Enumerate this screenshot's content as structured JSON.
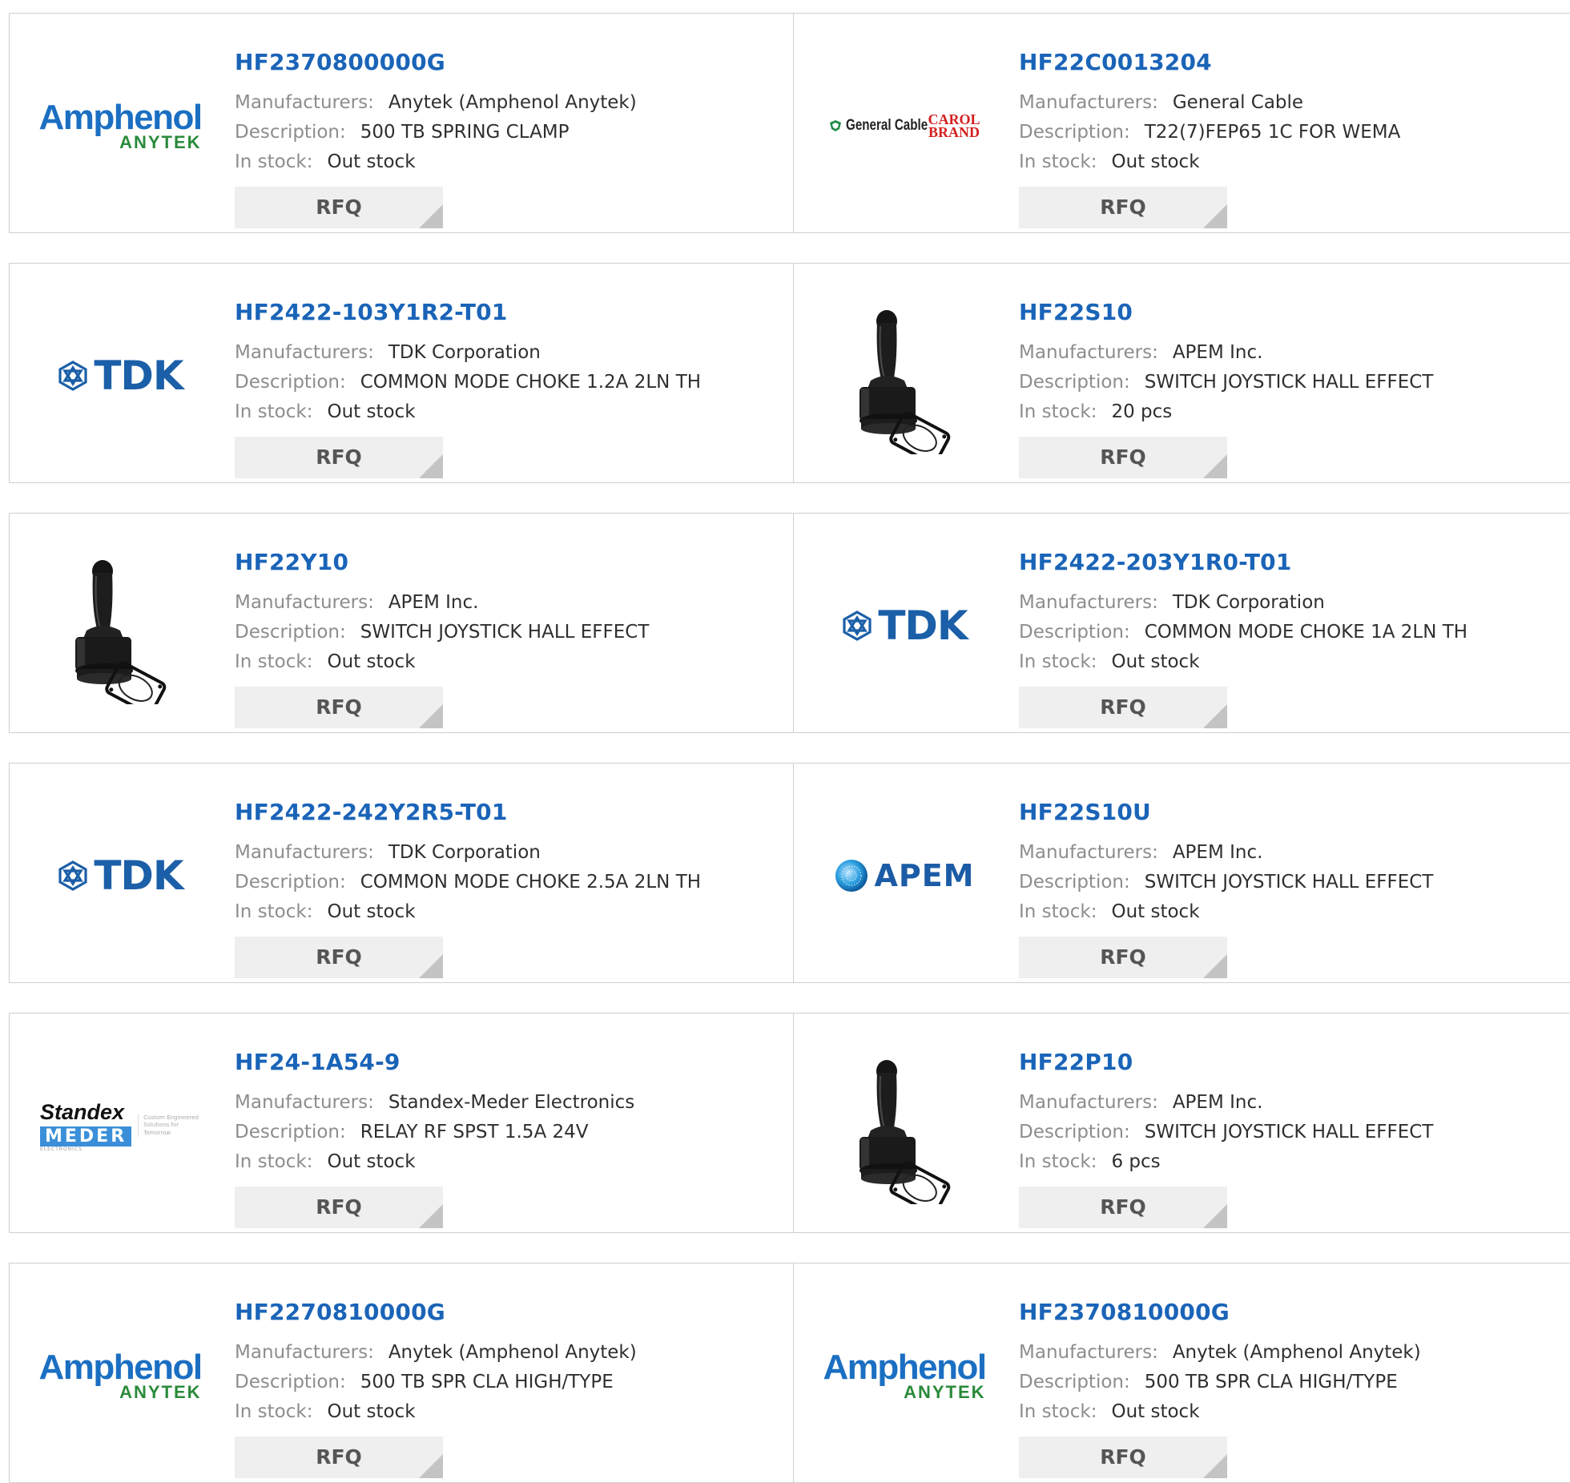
{
  "labels": {
    "manufacturers": "Manufacturers:",
    "description": "Description:",
    "in_stock": "In stock:",
    "rfq": "RFQ"
  },
  "brand_logos": {
    "amphenol": {
      "line1": "Amphenol",
      "line2": "ANYTEK"
    },
    "tdk": {
      "text": "TDK"
    },
    "apem": {
      "text": "APEM"
    },
    "general_cable": {
      "line1": "General Cable",
      "line2": "CAROL",
      "line3": "BRAND"
    },
    "standex": {
      "line1": "Standex",
      "line2": "MEDER",
      "line3": "ELECTRONICS",
      "tagline": "Custom Engineered Solutions for Tomorrow"
    }
  },
  "colors": {
    "part_link": "#1a64b8",
    "label": "#8d8d8d",
    "value": "#2f2f2f",
    "rfq_bg": "#efefef",
    "border": "#cfcfcf"
  },
  "products": [
    {
      "part": "HF2370800000G",
      "manufacturer": "Anytek (Amphenol Anytek)",
      "description": "500 TB SPRING CLAMP",
      "stock": "Out stock",
      "logo": "amphenol-logo"
    },
    {
      "part": "HF22C0013204",
      "manufacturer": "General Cable",
      "description": "T22(7)FEP65 1C FOR WEMA",
      "stock": "Out stock",
      "logo": "general-cable-logo"
    },
    {
      "part": "HF2422-103Y1R2-T01",
      "manufacturer": "TDK Corporation",
      "description": "COMMON MODE CHOKE 1.2A 2LN TH",
      "stock": "Out stock",
      "logo": "tdk-logo"
    },
    {
      "part": "HF22S10",
      "manufacturer": "APEM Inc.",
      "description": "SWITCH JOYSTICK HALL EFFECT",
      "stock": "20 pcs",
      "logo": "joystick-image"
    },
    {
      "part": "HF22Y10",
      "manufacturer": "APEM Inc.",
      "description": "SWITCH JOYSTICK HALL EFFECT",
      "stock": "Out stock",
      "logo": "joystick-image"
    },
    {
      "part": "HF2422-203Y1R0-T01",
      "manufacturer": "TDK Corporation",
      "description": "COMMON MODE CHOKE 1A 2LN TH",
      "stock": "Out stock",
      "logo": "tdk-logo"
    },
    {
      "part": "HF2422-242Y2R5-T01",
      "manufacturer": "TDK Corporation",
      "description": "COMMON MODE CHOKE 2.5A 2LN TH",
      "stock": "Out stock",
      "logo": "tdk-logo"
    },
    {
      "part": "HF22S10U",
      "manufacturer": "APEM Inc.",
      "description": "SWITCH JOYSTICK HALL EFFECT",
      "stock": "Out stock",
      "logo": "apem-logo"
    },
    {
      "part": "HF24-1A54-9",
      "manufacturer": "Standex-Meder Electronics",
      "description": "RELAY RF SPST 1.5A 24V",
      "stock": "Out stock",
      "logo": "standex-meder-logo"
    },
    {
      "part": "HF22P10",
      "manufacturer": "APEM Inc.",
      "description": "SWITCH JOYSTICK HALL EFFECT",
      "stock": "6 pcs",
      "logo": "joystick-image"
    },
    {
      "part": "HF2270810000G",
      "manufacturer": "Anytek (Amphenol Anytek)",
      "description": "500 TB SPR CLA HIGH/TYPE",
      "stock": "Out stock",
      "logo": "amphenol-logo"
    },
    {
      "part": "HF2370810000G",
      "manufacturer": "Anytek (Amphenol Anytek)",
      "description": "500 TB SPR CLA HIGH/TYPE",
      "stock": "Out stock",
      "logo": "amphenol-logo"
    }
  ]
}
